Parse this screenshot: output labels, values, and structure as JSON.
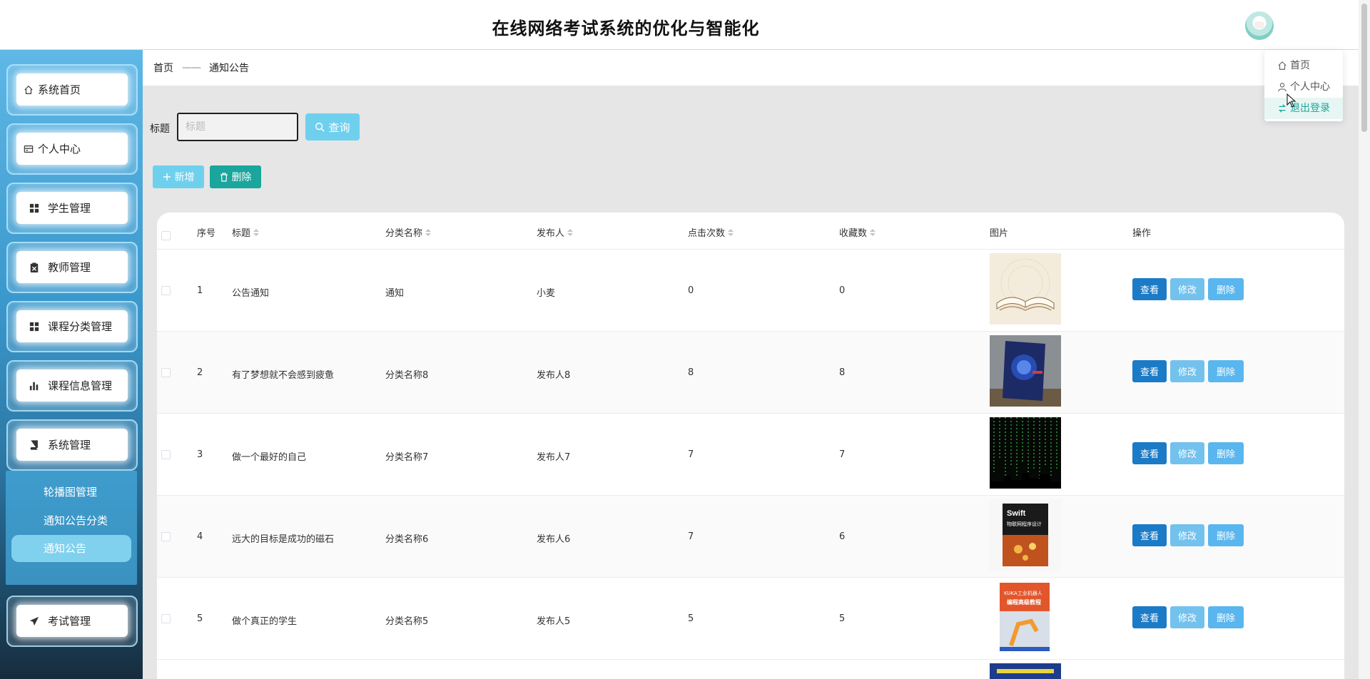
{
  "header": {
    "title": "在线网络考试系统的优化与智能化"
  },
  "user_menu": {
    "items": [
      {
        "label": "首页",
        "icon": "home-icon"
      },
      {
        "label": "个人中心",
        "icon": "user-icon"
      },
      {
        "label": "退出登录",
        "icon": "logout-icon"
      }
    ]
  },
  "sidebar": {
    "items": [
      {
        "label": "系统首页",
        "icon": "home-icon"
      },
      {
        "label": "个人中心",
        "icon": "card-icon"
      },
      {
        "label": "学生管理",
        "icon": "grid-icon"
      },
      {
        "label": "教师管理",
        "icon": "clipboard-icon"
      },
      {
        "label": "课程分类管理",
        "icon": "grid-icon"
      },
      {
        "label": "课程信息管理",
        "icon": "bar-chart-icon"
      },
      {
        "label": "系统管理",
        "icon": "book-icon"
      },
      {
        "label": "考试管理",
        "icon": "send-icon"
      }
    ],
    "submenu": [
      "轮播图管理",
      "通知公告分类",
      "通知公告"
    ]
  },
  "breadcrumb": {
    "home": "首页",
    "separator": "——",
    "current": "通知公告"
  },
  "search": {
    "label": "标题",
    "placeholder": "标题",
    "button": "查询"
  },
  "toolbar": {
    "add": "新增",
    "delete": "删除"
  },
  "table": {
    "columns": [
      "序号",
      "标题",
      "分类名称",
      "发布人",
      "点击次数",
      "收藏数",
      "图片",
      "操作"
    ],
    "rows": [
      {
        "index": "1",
        "title": "公告通知",
        "category": "通知",
        "publisher": "小麦",
        "clicks": "0",
        "favorites": "0"
      },
      {
        "index": "2",
        "title": "有了梦想就不会感到疲惫",
        "category": "分类名称8",
        "publisher": "发布人8",
        "clicks": "8",
        "favorites": "8"
      },
      {
        "index": "3",
        "title": "做一个最好的自己",
        "category": "分类名称7",
        "publisher": "发布人7",
        "clicks": "7",
        "favorites": "7"
      },
      {
        "index": "4",
        "title": "远大的目标是成功的磁石",
        "category": "分类名称6",
        "publisher": "发布人6",
        "clicks": "7",
        "favorites": "6"
      },
      {
        "index": "5",
        "title": "做个真正的学生",
        "category": "分类名称5",
        "publisher": "发布人5",
        "clicks": "5",
        "favorites": "5"
      }
    ],
    "actions": {
      "view": "查看",
      "edit": "修改",
      "delete": "删除"
    },
    "image_texts": {
      "book4": "Swift",
      "book4_sub": "物联网程序设计",
      "book5": "KUKA工业机器人",
      "book5_sub": "编程高级教程"
    }
  },
  "colors": {
    "accent": "#6fd0ee",
    "delete": "#1aa59d",
    "view": "#1b7bc6"
  }
}
